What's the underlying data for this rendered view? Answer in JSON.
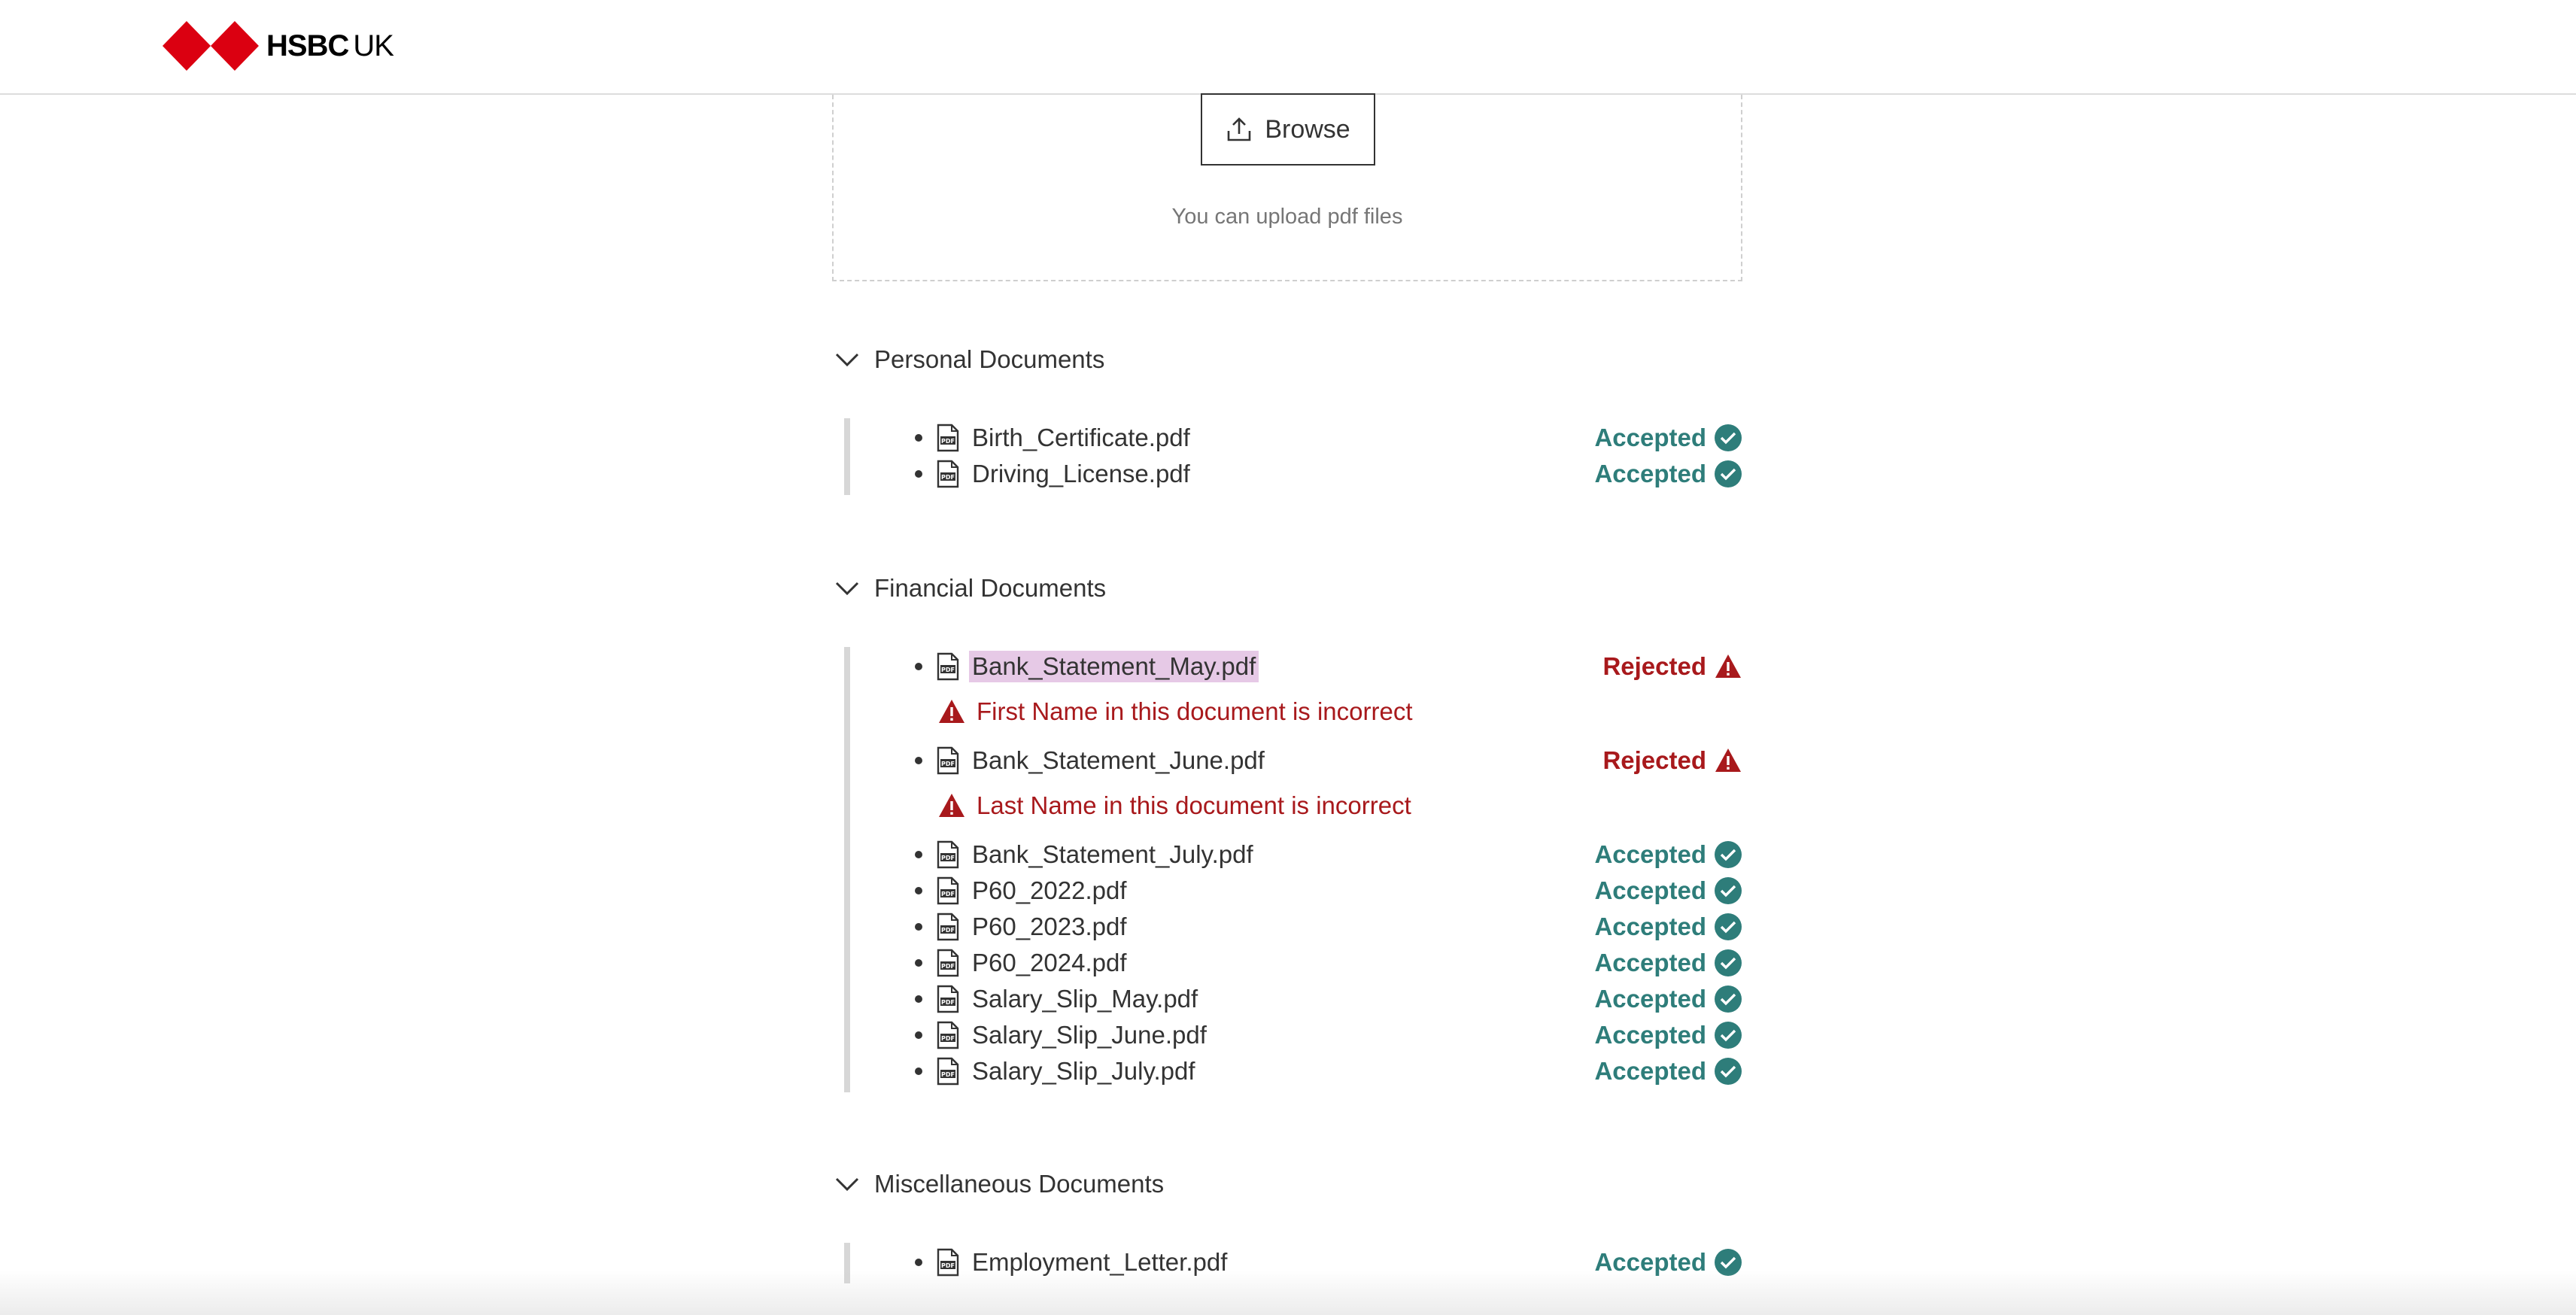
{
  "header": {
    "brand": "HSBC",
    "brand_suffix": "UK"
  },
  "upload": {
    "browse_label": "Browse",
    "hint": "You can upload pdf files"
  },
  "sections": [
    {
      "title": "Personal Documents",
      "docs": [
        {
          "name": "Birth_Certificate.pdf",
          "status": "Accepted"
        },
        {
          "name": "Driving_License.pdf",
          "status": "Accepted"
        }
      ]
    },
    {
      "title": "Financial Documents",
      "docs": [
        {
          "name": "Bank_Statement_May.pdf",
          "status": "Rejected",
          "error": "First Name in this document is incorrect"
        },
        {
          "name": "Bank_Statement_June.pdf",
          "status": "Rejected",
          "error": "Last Name in this document is incorrect"
        },
        {
          "name": "Bank_Statement_July.pdf",
          "status": "Accepted"
        },
        {
          "name": "P60_2022.pdf",
          "status": "Accepted"
        },
        {
          "name": "P60_2023.pdf",
          "status": "Accepted"
        },
        {
          "name": "P60_2024.pdf",
          "status": "Accepted"
        },
        {
          "name": "Salary_Slip_May.pdf",
          "status": "Accepted"
        },
        {
          "name": "Salary_Slip_June.pdf",
          "status": "Accepted"
        },
        {
          "name": "Salary_Slip_July.pdf",
          "status": "Accepted"
        }
      ]
    },
    {
      "title": "Miscellaneous Documents",
      "docs": [
        {
          "name": "Employment_Letter.pdf",
          "status": "Accepted"
        }
      ]
    }
  ],
  "colors": {
    "accepted": "#2e7d7a",
    "rejected": "#a8191c",
    "brand_red": "#db0011"
  },
  "icons": {
    "upload": "upload-icon",
    "chevron": "chevron-down-icon",
    "pdf": "pdf-file-icon",
    "accepted": "check-circle-icon",
    "rejected": "warning-triangle-icon"
  }
}
